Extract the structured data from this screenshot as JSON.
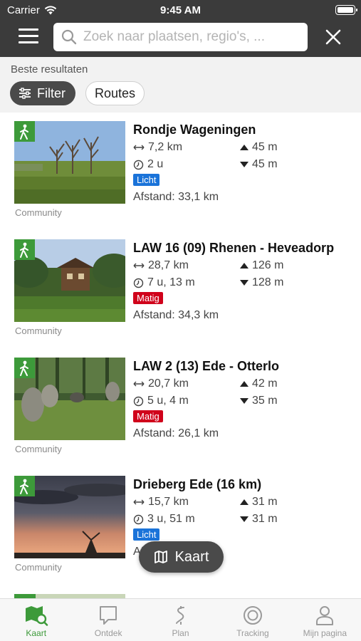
{
  "status_bar": {
    "carrier": "Carrier",
    "time": "9:45 AM"
  },
  "search": {
    "placeholder": "Zoek naar plaatsen, regio's, ..."
  },
  "filters": {
    "section_label": "Beste resultaten",
    "filter_label": "Filter",
    "routes_label": "Routes"
  },
  "routes": [
    {
      "title": "Rondje Wageningen",
      "distance": "7,2 km",
      "duration": "2 u",
      "ascent": "45 m",
      "descent": "45 m",
      "difficulty": "Licht",
      "difficulty_color": "#1a73d9",
      "away": "Afstand: 33,1 km",
      "source": "Community"
    },
    {
      "title": "LAW 16 (09) Rhenen - Heveadorp",
      "distance": "28,7 km",
      "duration": "7 u, 13 m",
      "ascent": "126 m",
      "descent": "128 m",
      "difficulty": "Matig",
      "difficulty_color": "#d0021b",
      "away": "Afstand: 34,3 km",
      "source": "Community"
    },
    {
      "title": "LAW 2 (13) Ede - Otterlo",
      "distance": "20,7 km",
      "duration": "5 u, 4 m",
      "ascent": "42 m",
      "descent": "35 m",
      "difficulty": "Matig",
      "difficulty_color": "#d0021b",
      "away": "Afstand: 26,1 km",
      "source": "Community"
    },
    {
      "title": "Drieberg Ede (16 km)",
      "distance": "15,7 km",
      "duration": "3 u, 51 m",
      "ascent": "31 m",
      "descent": "31 m",
      "difficulty": "Licht",
      "difficulty_color": "#1a73d9",
      "away": "Afstand",
      "source": "Community"
    }
  ],
  "map_button": {
    "label": "Kaart"
  },
  "tabs": [
    {
      "label": "Kaart",
      "icon": "map-search-icon",
      "active": true
    },
    {
      "label": "Ontdek",
      "icon": "chat-bubble-icon",
      "active": false
    },
    {
      "label": "Plan",
      "icon": "route-s-icon",
      "active": false
    },
    {
      "label": "Tracking",
      "icon": "target-icon",
      "active": false
    },
    {
      "label": "Mijn pagina",
      "icon": "person-icon",
      "active": false
    }
  ],
  "colors": {
    "header": "#3b3b3b",
    "accent_green": "#3d9a3a",
    "chip_dark": "#4a4a4a"
  }
}
